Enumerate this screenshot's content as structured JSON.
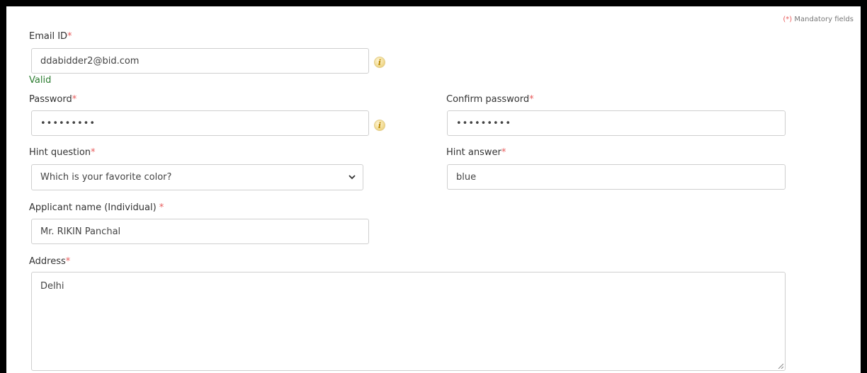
{
  "mandatory_note": {
    "marker": "(*)",
    "text": " Mandatory fields"
  },
  "required_marker": "*",
  "email": {
    "label": "Email ID",
    "value": "ddabidder2@bid.com",
    "status": "Valid",
    "info_icon": "info-icon"
  },
  "password": {
    "label": "Password",
    "value": "•••••••••",
    "info_icon": "info-icon"
  },
  "confirm_password": {
    "label": "Confirm password",
    "value": "•••••••••"
  },
  "hint_question": {
    "label": "Hint question",
    "selected": "Which is your favorite color?",
    "chevron_icon": "chevron-down-icon"
  },
  "hint_answer": {
    "label": "Hint answer",
    "value": "blue"
  },
  "applicant_name": {
    "label": "Applicant name (Individual) ",
    "value": "Mr. RIKIN Panchal"
  },
  "address": {
    "label": "Address",
    "value": "Delhi"
  },
  "colors": {
    "required": "#e85c5c",
    "valid": "#2e7d32",
    "border": "#cfcfcf",
    "frame": "#000000"
  }
}
